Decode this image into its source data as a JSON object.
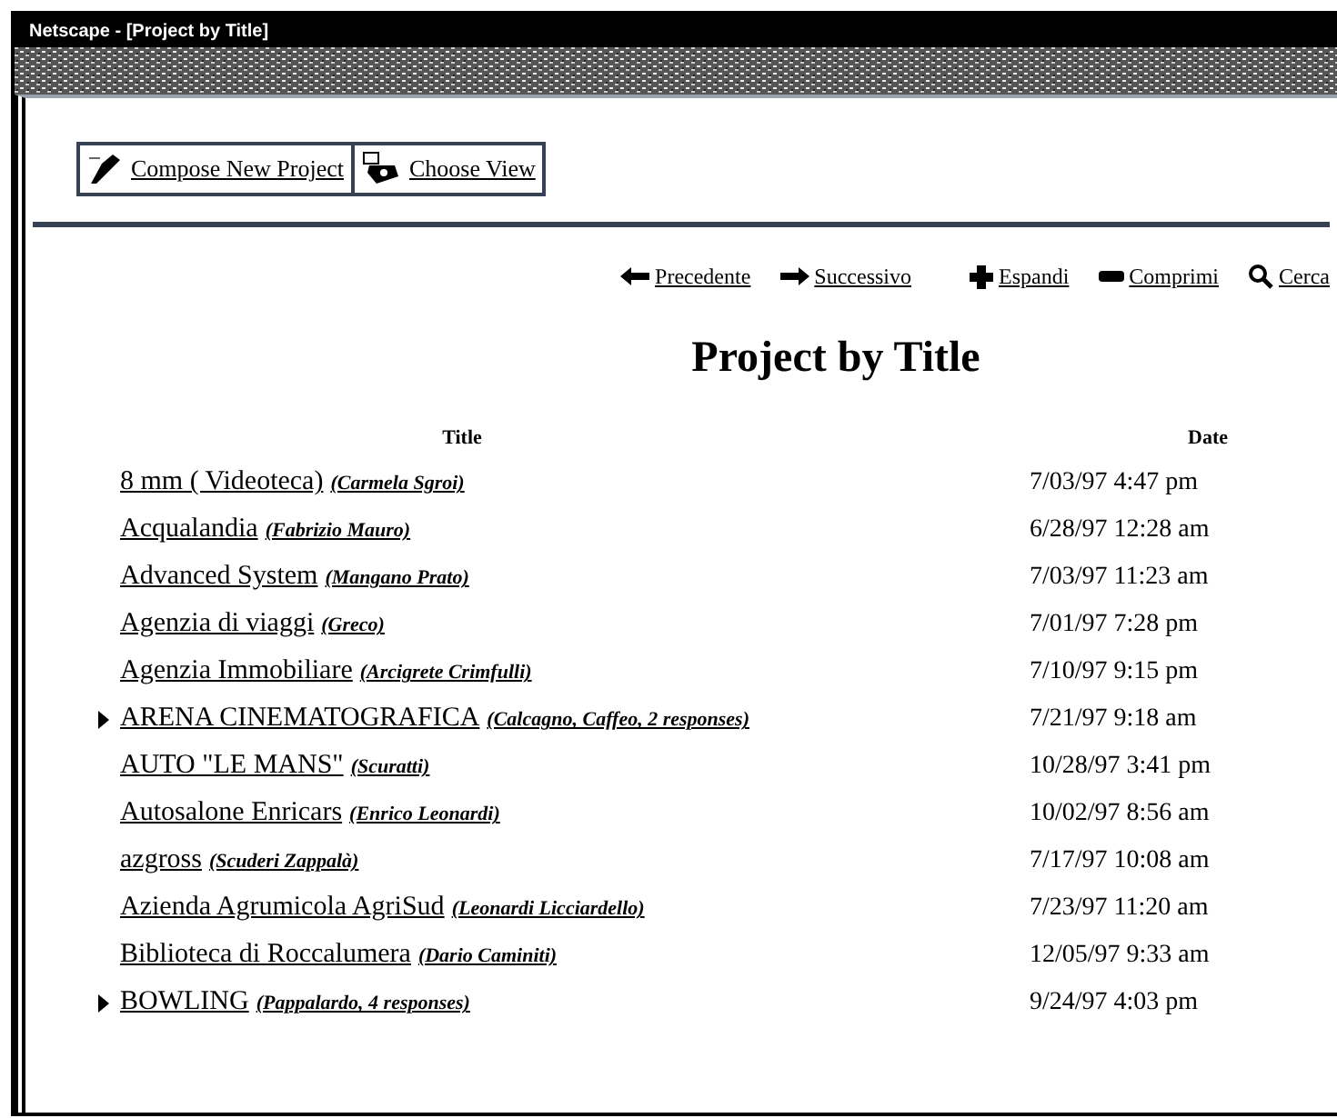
{
  "window": {
    "title": "Netscape - [Project by Title]"
  },
  "toolbar": [
    {
      "kind": "compose",
      "label": "Compose New Project"
    },
    {
      "kind": "view",
      "label": "Choose View"
    }
  ],
  "nav": [
    {
      "kind": "previous",
      "label": "Precedente"
    },
    {
      "kind": "next",
      "label": "Successivo"
    },
    {
      "kind": "expand",
      "label": "Espandi"
    },
    {
      "kind": "collapse",
      "label": "Comprimi"
    },
    {
      "kind": "search",
      "label": "Cerca"
    }
  ],
  "heading": "Project by Title",
  "table": {
    "columns": [
      "Title",
      "Date"
    ],
    "rows": [
      {
        "title": "8 mm ( Videoteca)",
        "author": "(Carmela Sgroi)",
        "date": "7/03/97 4:47 pm",
        "expandable": false
      },
      {
        "title": "Acqualandia",
        "author": "(Fabrizio Mauro)",
        "date": "6/28/97 12:28 am",
        "expandable": false
      },
      {
        "title": "Advanced System",
        "author": "(Mangano Prato)",
        "date": "7/03/97 11:23 am",
        "expandable": false
      },
      {
        "title": "Agenzia di viaggi",
        "author": "(Greco)",
        "date": "7/01/97 7:28 pm",
        "expandable": false
      },
      {
        "title": "Agenzia Immobiliare",
        "author": "(Arcigrete Crimfulli)",
        "date": "7/10/97 9:15 pm",
        "expandable": false
      },
      {
        "title": "ARENA CINEMATOGRAFICA",
        "author": "(Calcagno, Caffeo, 2 responses)",
        "date": "7/21/97 9:18 am",
        "expandable": true
      },
      {
        "title": "AUTO \"LE MANS\"",
        "author": "(Scuratti)",
        "date": "10/28/97 3:41 pm",
        "expandable": false
      },
      {
        "title": "Autosalone Enricars",
        "author": "(Enrico Leonardi)",
        "date": "10/02/97 8:56 am",
        "expandable": false
      },
      {
        "title": "azgross",
        "author": "(Scuderi Zappalà)",
        "date": "7/17/97 10:08 am",
        "expandable": false
      },
      {
        "title": "Azienda Agrumicola AgriSud",
        "author": "(Leonardi Licciardello)",
        "date": "7/23/97 11:20 am",
        "expandable": false
      },
      {
        "title": "Biblioteca di Roccalumera",
        "author": "(Dario Caminiti)",
        "date": "12/05/97 9:33 am",
        "expandable": false
      },
      {
        "title": "BOWLING",
        "author": "(Pappalardo, 4 responses)",
        "date": "9/24/97 4:03 pm",
        "expandable": true
      }
    ]
  }
}
